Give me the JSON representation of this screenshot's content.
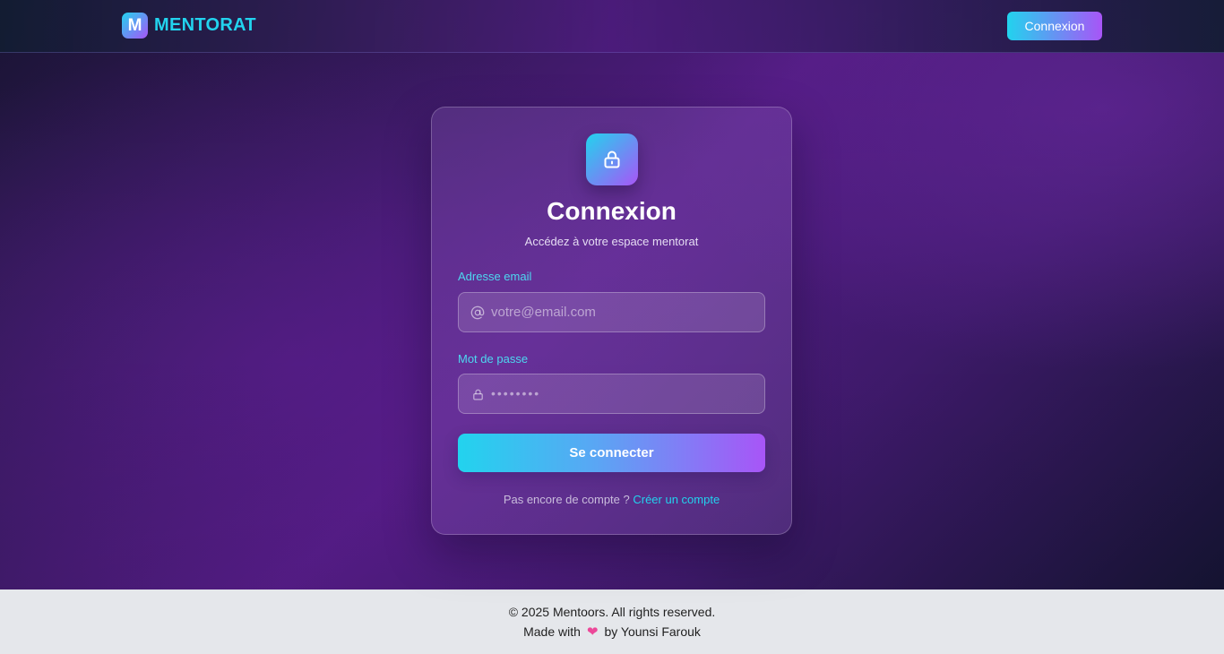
{
  "navbar": {
    "brand_mark": "M",
    "brand_name": "MENTORAT",
    "login_button": "Connexion"
  },
  "card": {
    "icon": "lock-icon",
    "title": "Connexion",
    "subtitle": "Accédez à votre espace mentorat",
    "email": {
      "label": "Adresse email",
      "icon": "at-sign-icon",
      "placeholder": "votre@email.com",
      "value": ""
    },
    "password": {
      "label": "Mot de passe",
      "icon": "lock-icon",
      "placeholder": "••••••••",
      "value": ""
    },
    "submit_label": "Se connecter",
    "signup_prompt": "Pas encore de compte ?",
    "signup_link": "Créer un compte"
  },
  "footer": {
    "copyright": "© 2025 Mentoors. All rights reserved.",
    "made_with_prefix": "Made with",
    "heart_icon": "heart-icon",
    "made_with_suffix": "by Younsi Farouk"
  },
  "colors": {
    "accent_cyan": "#22d3ee",
    "accent_purple": "#a855f7",
    "heart": "#ec4899",
    "footer_bg": "#e5e7eb"
  }
}
